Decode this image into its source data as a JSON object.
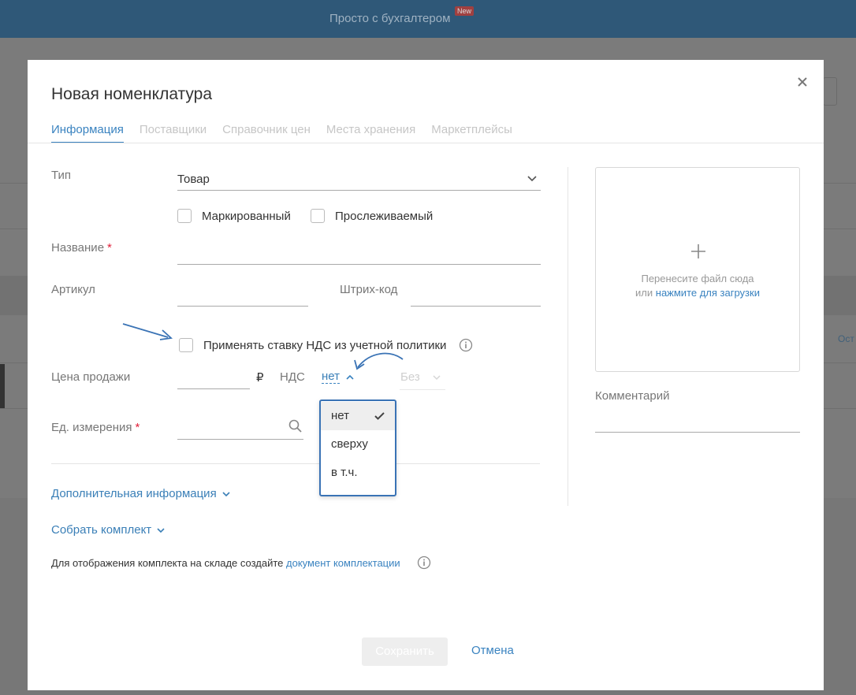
{
  "background": {
    "header_title": "Просто с бухгалтером",
    "header_badge": "New",
    "side_text": "Ост"
  },
  "modal": {
    "title": "Новая номенклатура",
    "tabs": [
      {
        "label": "Информация",
        "active": true
      },
      {
        "label": "Поставщики",
        "active": false
      },
      {
        "label": "Справочник цен",
        "active": false
      },
      {
        "label": "Места хранения",
        "active": false
      },
      {
        "label": "Маркетплейсы",
        "active": false
      }
    ],
    "type_label": "Тип",
    "type_value": "Товар",
    "checkbox_marked": "Маркированный",
    "checkbox_tracked": "Прослеживаемый",
    "name_label": "Название",
    "required_mark": "*",
    "article_label": "Артикул",
    "barcode_label": "Штрих-код",
    "vat_policy_checkbox": "Применять ставку НДС из учетной политики",
    "price_label": "Цена продажи",
    "currency_symbol": "₽",
    "vat_label": "НДС",
    "vat_value": "нет",
    "vat_rate_value": "Без",
    "unit_label": "Ед. измерения",
    "vat_options": [
      {
        "label": "нет",
        "selected": true
      },
      {
        "label": "сверху",
        "selected": false
      },
      {
        "label": "в т.ч.",
        "selected": false
      }
    ],
    "additional_info_link": "Дополнительная информация",
    "assemble_kit_link": "Собрать комплект",
    "kit_hint_text": "Для отображения комплекта на складе создайте ",
    "kit_hint_link": "документ комплектации",
    "upload_text_line1": "Перенесите файл сюда",
    "upload_text_or": "или ",
    "upload_link": "нажмите для загрузки",
    "comment_label": "Комментарий",
    "save_label": "Сохранить",
    "cancel_label": "Отмена"
  },
  "colors": {
    "accent": "#3a83c0",
    "required": "#e0203a",
    "dropdown_border": "#3a73b5"
  }
}
